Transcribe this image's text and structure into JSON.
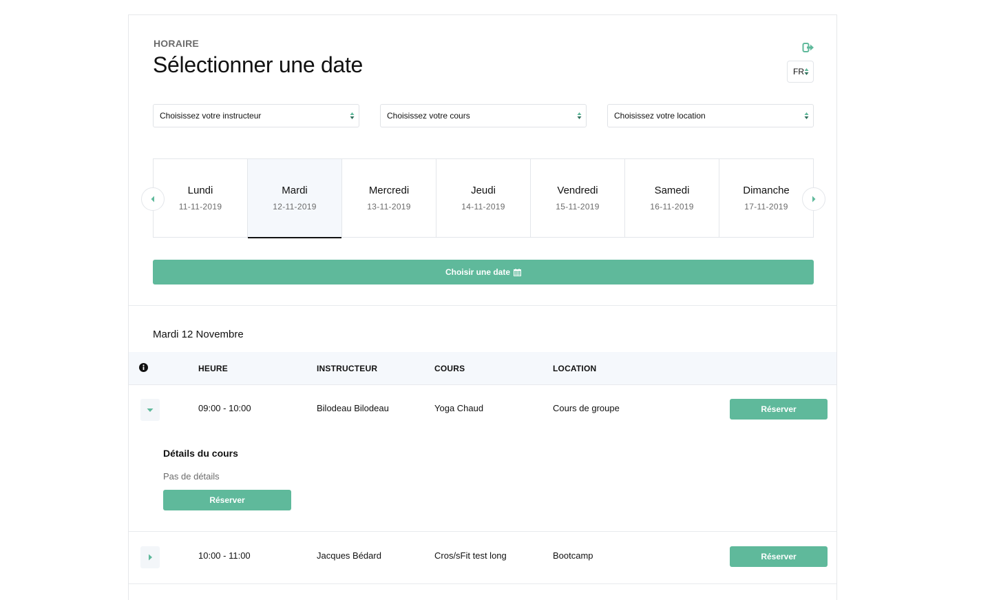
{
  "header": {
    "eyebrow": "HORAIRE",
    "title": "Sélectionner une date",
    "language": "FR"
  },
  "filters": {
    "instructor_placeholder": "Choisissez votre instructeur",
    "course_placeholder": "Choisissez votre cours",
    "location_placeholder": "Choisissez votre location"
  },
  "week": {
    "days": [
      {
        "name": "Lundi",
        "date": "11-11-2019"
      },
      {
        "name": "Mardi",
        "date": "12-11-2019"
      },
      {
        "name": "Mercredi",
        "date": "13-11-2019"
      },
      {
        "name": "Jeudi",
        "date": "14-11-2019"
      },
      {
        "name": "Vendredi",
        "date": "15-11-2019"
      },
      {
        "name": "Samedi",
        "date": "16-11-2019"
      },
      {
        "name": "Dimanche",
        "date": "17-11-2019"
      }
    ],
    "selected_index": 1
  },
  "choose_date_label": "Choisir une date",
  "schedule": {
    "heading": "Mardi 12 Novembre",
    "columns": {
      "time": "HEURE",
      "instructor": "INSTRUCTEUR",
      "course": "COURS",
      "location": "LOCATION"
    },
    "rows": [
      {
        "time": "09:00 - 10:00",
        "instructor": "Bilodeau Bilodeau",
        "course": "Yoga Chaud",
        "location": "Cours de groupe",
        "reserve_label": "Réserver",
        "expanded": true
      },
      {
        "time": "10:00 - 11:00",
        "instructor": "Jacques Bédard",
        "course": "Cros/sFit test long",
        "location": "Bootcamp",
        "reserve_label": "Réserver",
        "expanded": false
      }
    ],
    "details": {
      "title": "Détails du cours",
      "text": "Pas de détails",
      "reserve_label": "Réserver"
    }
  },
  "colors": {
    "accent": "#5fb99b",
    "header_bg": "#f5f8fc",
    "muted_text": "#6b6b6b"
  }
}
